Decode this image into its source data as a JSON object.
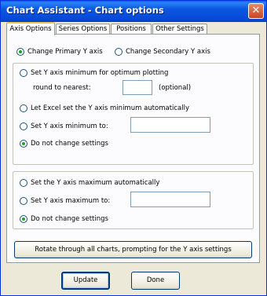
{
  "window": {
    "title": "Chart Assistant - Chart options",
    "close_glyph": "✕"
  },
  "tabs": [
    {
      "label": "Axis Options",
      "active": true
    },
    {
      "label": "Series Options",
      "active": false
    },
    {
      "label": "Positions",
      "active": false
    },
    {
      "label": "Other Settings",
      "active": false
    }
  ],
  "axis_choice": {
    "primary": {
      "label": "Change Primary Y axis",
      "selected": true
    },
    "secondary": {
      "label": "Change Secondary Y axis",
      "selected": false
    }
  },
  "minimum": {
    "optimum": {
      "label": "Set Y axis minimum for optimum plotting",
      "selected": false
    },
    "round_label": "round to nearest:",
    "round_value": "",
    "round_hint": "(optional)",
    "auto": {
      "label": "Let Excel set the Y axis minimum automatically",
      "selected": false
    },
    "set_to": {
      "label": "Set Y axis minimum to:",
      "selected": false,
      "value": ""
    },
    "no_change": {
      "label": "Do not change settings",
      "selected": true
    }
  },
  "maximum": {
    "auto": {
      "label": "Set the Y axis maximum automatically",
      "selected": false
    },
    "set_to": {
      "label": "Set Y axis maximum to:",
      "selected": false,
      "value": ""
    },
    "no_change": {
      "label": "Do not change settings",
      "selected": true
    }
  },
  "rotate_button": "Rotate through all charts, prompting for the Y axis settings",
  "buttons": {
    "update": "Update",
    "done": "Done"
  },
  "colors": {
    "titlebar": "#0b57e0",
    "face": "#ece9d8",
    "accent": "#f5c44b",
    "radio_dot": "#21a121"
  }
}
